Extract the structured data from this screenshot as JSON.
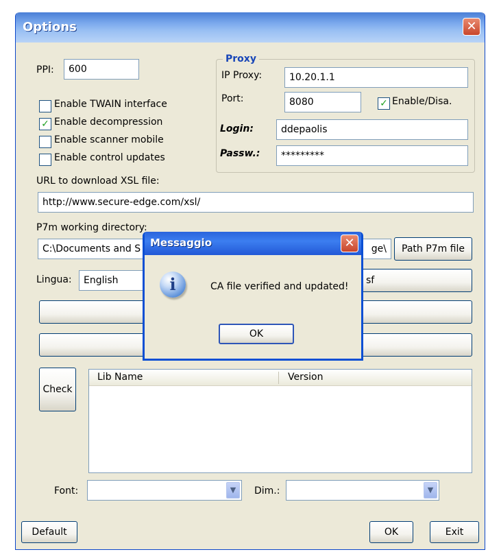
{
  "window": {
    "title": "Options",
    "close_label": "✕"
  },
  "general": {
    "ppi_label": "PPI:",
    "ppi_value": "600",
    "options": [
      {
        "label": "Enable TWAIN interface",
        "checked": false
      },
      {
        "label": "Enable decompression",
        "checked": true
      },
      {
        "label": "Enable scanner mobile",
        "checked": false
      },
      {
        "label": "Enable control updates",
        "checked": false
      }
    ],
    "check_mark": "✓"
  },
  "proxy": {
    "group_label": "Proxy",
    "ip_label": "IP Proxy:",
    "ip_value": "10.20.1.1",
    "port_label": "Port:",
    "port_value": "8080",
    "enable_label": "Enable/Disa.",
    "enable_checked": true,
    "login_label": "Login:",
    "login_value": "ddepaolis",
    "password_label": "Passw.:",
    "password_value": "*********"
  },
  "xsl": {
    "label": "URL to download XSL file:",
    "value": "http://www.secure-edge.com/xsl/"
  },
  "p7m": {
    "label": "P7m working directory:",
    "value_left": "C:\\Documents and S",
    "value_right": "ge\\",
    "path_button": "Path P7m file"
  },
  "language": {
    "label": "Lingua:",
    "value": "English",
    "right_button_text": "sf"
  },
  "libs": {
    "check_button": "Check",
    "columns": [
      "Lib Name",
      "Version"
    ]
  },
  "font": {
    "font_label": "Font:",
    "dim_label": "Dim.:",
    "arrow": "▼"
  },
  "footer": {
    "default_button": "Default",
    "ok_button": "OK",
    "exit_button": "Exit"
  },
  "dialog": {
    "title": "Messaggio",
    "close_label": "✕",
    "icon_glyph": "i",
    "message": "CA file verified and updated!",
    "ok_button": "OK"
  }
}
